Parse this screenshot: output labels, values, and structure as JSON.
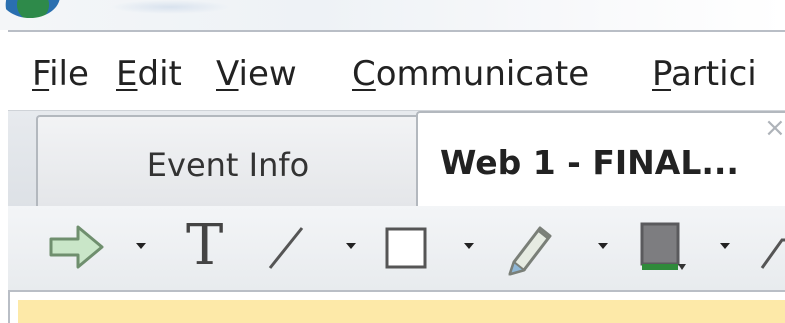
{
  "menu": {
    "items": [
      {
        "key": "F",
        "rest": "ile"
      },
      {
        "key": "E",
        "rest": "dit"
      },
      {
        "key": "V",
        "rest": "iew"
      },
      {
        "key": "C",
        "rest": "ommunicate"
      },
      {
        "key": "P",
        "rest": "artici"
      }
    ]
  },
  "tabs": {
    "event_info": "Event Info",
    "web1": "Web 1 - FINAL...",
    "close_glyph": "×"
  },
  "toolbar": {
    "text_tool_glyph": "T",
    "icons": [
      "arrow-pointer-icon",
      "text-tool-icon",
      "line-tool-icon",
      "rectangle-tool-icon",
      "pencil-tool-icon",
      "fill-color-icon",
      "eraser-icon"
    ],
    "colors": {
      "arrow_fill": "#c9e6c8",
      "fill_color": "#7d7d80",
      "banner": "#fde9a8"
    }
  }
}
